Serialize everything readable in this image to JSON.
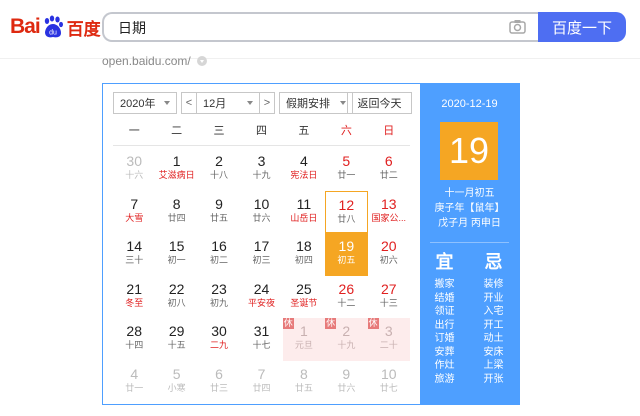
{
  "logo": {
    "latin": "Bai",
    "du": "du",
    "cn": "百度"
  },
  "search": {
    "value": "日期",
    "button": "百度一下"
  },
  "result_url": "open.baidu.com/",
  "calendar": {
    "year_select": "2020年",
    "month_select": "12月",
    "holiday_select": "假期安排",
    "today_button": "返回今天",
    "prev": "<",
    "next": ">",
    "weekdays": [
      "一",
      "二",
      "三",
      "四",
      "五",
      "六",
      "日"
    ],
    "weeks": [
      [
        {
          "d": "30",
          "l": "十六",
          "s": "dim"
        },
        {
          "d": "1",
          "l": "艾滋病日",
          "s": "fest"
        },
        {
          "d": "2",
          "l": "十八"
        },
        {
          "d": "3",
          "l": "十九"
        },
        {
          "d": "4",
          "l": "宪法日",
          "s": "fest"
        },
        {
          "d": "5",
          "l": "廿一",
          "s": "we"
        },
        {
          "d": "6",
          "l": "廿二",
          "s": "we"
        }
      ],
      [
        {
          "d": "7",
          "l": "大雪",
          "s": "fest"
        },
        {
          "d": "8",
          "l": "廿四"
        },
        {
          "d": "9",
          "l": "廿五"
        },
        {
          "d": "10",
          "l": "廿六"
        },
        {
          "d": "11",
          "l": "山岳日",
          "s": "fest"
        },
        {
          "d": "12",
          "l": "廿八",
          "s": "we boxed"
        },
        {
          "d": "13",
          "l": "国家公...",
          "s": "we fest"
        }
      ],
      [
        {
          "d": "14",
          "l": "三十"
        },
        {
          "d": "15",
          "l": "初一"
        },
        {
          "d": "16",
          "l": "初二"
        },
        {
          "d": "17",
          "l": "初三"
        },
        {
          "d": "18",
          "l": "初四"
        },
        {
          "d": "19",
          "l": "初五",
          "s": "selected"
        },
        {
          "d": "20",
          "l": "初六",
          "s": "we"
        }
      ],
      [
        {
          "d": "21",
          "l": "冬至",
          "s": "fest"
        },
        {
          "d": "22",
          "l": "初八"
        },
        {
          "d": "23",
          "l": "初九"
        },
        {
          "d": "24",
          "l": "平安夜",
          "s": "fest"
        },
        {
          "d": "25",
          "l": "圣诞节",
          "s": "fest"
        },
        {
          "d": "26",
          "l": "十二",
          "s": "we"
        },
        {
          "d": "27",
          "l": "十三",
          "s": "we"
        }
      ],
      [
        {
          "d": "28",
          "l": "十四"
        },
        {
          "d": "29",
          "l": "十五"
        },
        {
          "d": "30",
          "l": "二九",
          "s": "fest"
        },
        {
          "d": "31",
          "l": "十七"
        },
        {
          "d": "1",
          "l": "元旦",
          "s": "hol",
          "tag": "休"
        },
        {
          "d": "2",
          "l": "十九",
          "s": "hol",
          "tag": "休"
        },
        {
          "d": "3",
          "l": "二十",
          "s": "hol",
          "tag": "休"
        }
      ],
      [
        {
          "d": "4",
          "l": "廿一",
          "s": "dim"
        },
        {
          "d": "5",
          "l": "小寒",
          "s": "dim"
        },
        {
          "d": "6",
          "l": "廿三",
          "s": "dim"
        },
        {
          "d": "7",
          "l": "廿四",
          "s": "dim"
        },
        {
          "d": "8",
          "l": "廿五",
          "s": "dim"
        },
        {
          "d": "9",
          "l": "廿六",
          "s": "dim"
        },
        {
          "d": "10",
          "l": "廿七",
          "s": "dim"
        }
      ]
    ],
    "side": {
      "date": "2020-12-19",
      "day": "19",
      "lunar_lines": [
        "十一月初五",
        "庚子年【鼠年】",
        "戊子月 丙申日"
      ],
      "yi_title": "宜",
      "ji_title": "忌",
      "yi": [
        "搬家",
        "结婚",
        "领证",
        "出行",
        "订婚",
        "安葬",
        "作灶",
        "旅游"
      ],
      "ji": [
        "装修",
        "开业",
        "入宅",
        "开工",
        "动土",
        "安床",
        "上梁",
        "开张"
      ]
    }
  }
}
